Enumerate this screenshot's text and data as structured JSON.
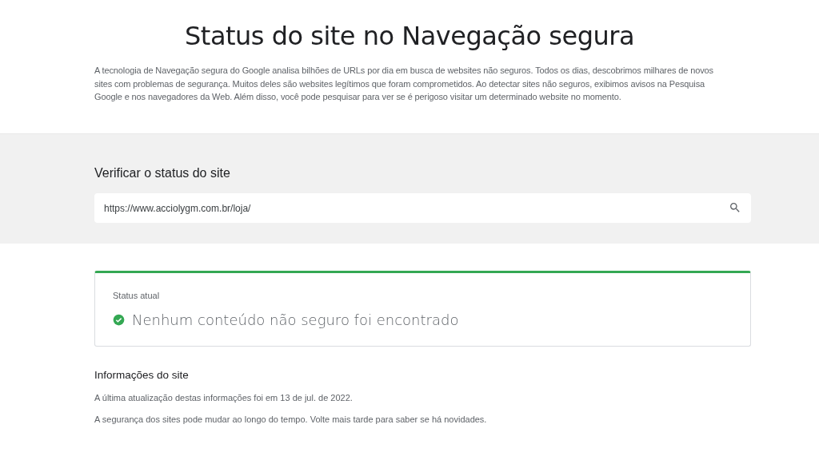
{
  "header": {
    "title": "Status do site no Navegação segura",
    "intro": "A tecnologia de Navegação segura do Google analisa bilhões de URLs por dia em busca de websites não seguros. Todos os dias, descobrimos milhares de novos sites com problemas de segurança. Muitos deles são websites legítimos que foram comprometidos. Ao detectar sites não seguros, exibimos avisos na Pesquisa Google e nos navegadores da Web. Além disso, você pode pesquisar para ver se é perigoso visitar um determinado website no momento."
  },
  "check": {
    "heading": "Verificar o status do site",
    "search": {
      "value": "https://www.acciolygm.com.br/loja/"
    }
  },
  "status": {
    "label": "Status atual",
    "kind": "safe",
    "message": "Nenhum conteúdo não seguro foi encontrado"
  },
  "info": {
    "heading": "Informações do site",
    "lines": [
      "A última atualização destas informações foi em 13 de jul. de 2022.",
      "A segurança dos sites pode mudar ao longo do tempo. Volte mais tarde para saber se há novidades."
    ]
  }
}
